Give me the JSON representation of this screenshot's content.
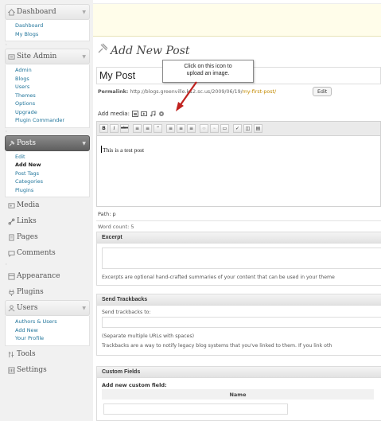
{
  "sidebar": {
    "groups": [
      {
        "title": "Dashboard",
        "icon": "home-icon",
        "items": [
          "Dashboard",
          "My Blogs"
        ]
      },
      {
        "title": "Site Admin",
        "icon": "site-admin-icon",
        "items": [
          "Admin",
          "Blogs",
          "Users",
          "Themes",
          "Options",
          "Upgrade",
          "Plugin Commander"
        ]
      },
      {
        "title": "Posts",
        "icon": "pin-icon",
        "items": [
          "Edit",
          "Add New",
          "Post Tags",
          "Categories",
          "Plugins"
        ],
        "current": "Add New"
      },
      {
        "title": "Media",
        "icon": "media-icon"
      },
      {
        "title": "Links",
        "icon": "links-icon"
      },
      {
        "title": "Pages",
        "icon": "pages-icon"
      },
      {
        "title": "Comments",
        "icon": "comments-icon"
      },
      {
        "title": "Appearance",
        "icon": "appearance-icon"
      },
      {
        "title": "Plugins",
        "icon": "plugins-icon"
      },
      {
        "title": "Users",
        "icon": "users-icon",
        "items": [
          "Authors & Users",
          "Add New",
          "Your Profile"
        ]
      },
      {
        "title": "Tools",
        "icon": "tools-icon"
      },
      {
        "title": "Settings",
        "icon": "settings-icon"
      }
    ]
  },
  "main": {
    "page_title": "Add New Post",
    "post_title": "My Post",
    "permalink_label": "Permalink:",
    "permalink_base": "http://blogs.greenville.k12.sc.us/2009/06/19/",
    "permalink_slug": "my-first-post/",
    "edit_label": "Edit",
    "add_media_label": "Add media:",
    "callout_line1": "Click on this icon to",
    "callout_line2": "upload an image.",
    "editor_text": "This is a test post",
    "path_label": "Path: p",
    "word_count": "Word count: 5",
    "excerpt": {
      "title": "Excerpt",
      "help": "Excerpts are optional hand-crafted summaries of your content that can be used in your theme"
    },
    "trackbacks": {
      "title": "Send Trackbacks",
      "label": "Send trackbacks to:",
      "note": "(Separate multiple URLs with spaces)",
      "help": "Trackbacks are a way to notify legacy blog systems that you've linked to them. If you link oth"
    },
    "custom_fields": {
      "title": "Custom Fields",
      "add_label": "Add new custom field:",
      "name_header": "Name"
    }
  },
  "colors": {
    "link": "#21759b",
    "slug": "#c38a00",
    "notice_bg": "#fffdea",
    "active_menu": "#6d6d6d"
  }
}
